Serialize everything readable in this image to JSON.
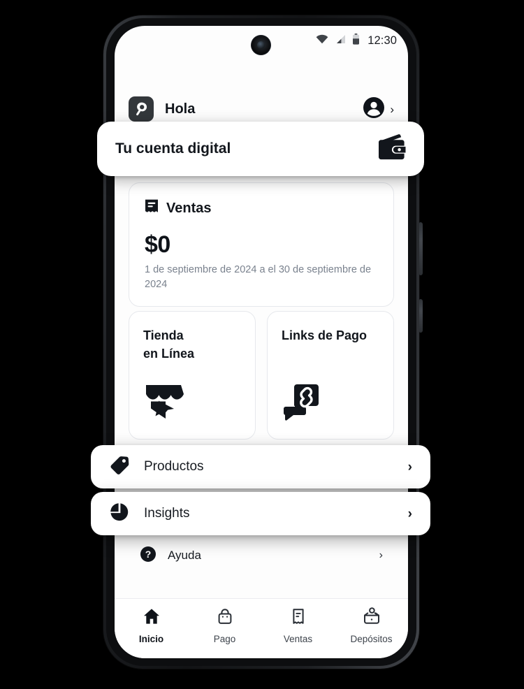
{
  "status_bar": {
    "time": "12:30",
    "icons": [
      "wifi-icon",
      "cellular-signal-icon",
      "battery-icon"
    ]
  },
  "header": {
    "logo": "clip-brand-logo",
    "greeting": "Hola",
    "account_icon": "account-avatar-icon",
    "chevron": "›"
  },
  "spotlight_account": {
    "title": "Tu cuenta digital",
    "icon": "wallet-icon"
  },
  "sales_card": {
    "icon": "receipt-icon",
    "title": "Ventas",
    "amount": "$0",
    "period": "1 de septiembre de 2024 a el 30 de septiembre de 2024"
  },
  "tiles": [
    {
      "title": "Tienda\nen Línea",
      "line1": "Tienda",
      "line2": "en Línea",
      "icon": "storefront-icon"
    },
    {
      "title": "Links de Pago",
      "line1": "Links de Pago",
      "line2": "",
      "icon": "payment-link-chat-icon"
    }
  ],
  "list_rows": [
    {
      "label": "Productos",
      "icon": "price-tag-icon",
      "chevron": "›",
      "spotlight": true
    },
    {
      "label": "Insights",
      "icon": "pie-chart-icon",
      "chevron": "›",
      "spotlight": true
    },
    {
      "label": "Ayuda",
      "icon": "help-question-icon",
      "chevron": "›",
      "spotlight": false
    }
  ],
  "bottom_nav": {
    "items": [
      {
        "label": "Inicio",
        "icon": "home-icon",
        "active": true
      },
      {
        "label": "Pago",
        "icon": "shopping-bag-icon",
        "active": false
      },
      {
        "label": "Ventas",
        "icon": "receipt-icon",
        "active": false
      },
      {
        "label": "Depósitos",
        "icon": "deposit-tray-icon",
        "active": false
      }
    ]
  },
  "colors": {
    "background": "#000000",
    "screen": "#fdfdfd",
    "ink": "#12161c",
    "muted": "#7a828e",
    "card_border": "#e6e8ec"
  }
}
